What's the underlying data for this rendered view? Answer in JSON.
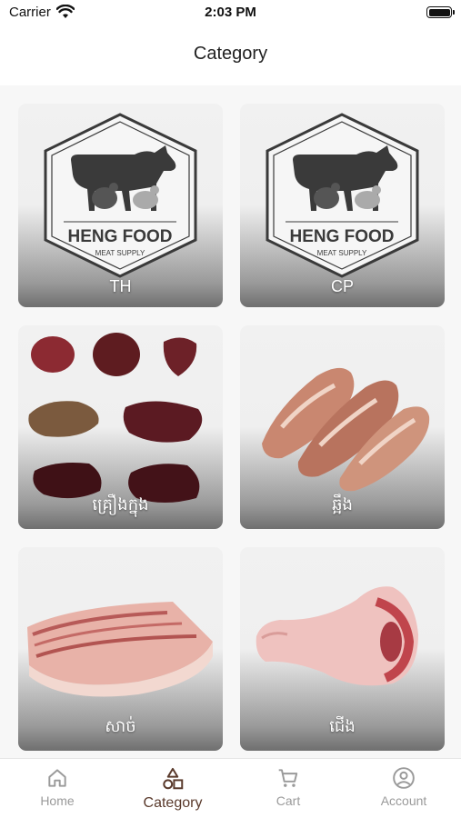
{
  "status_bar": {
    "carrier": "Carrier",
    "time": "2:03 PM"
  },
  "header": {
    "title": "Category"
  },
  "logo": {
    "brand_text": "HENG FOOD",
    "tagline": "MEAT SUPPLY"
  },
  "categories": [
    {
      "label": "TH",
      "image": "heng-food-logo"
    },
    {
      "label": "CP",
      "image": "heng-food-logo"
    },
    {
      "label": "គ្រឿងក្នុង",
      "image": "offal-pieces"
    },
    {
      "label": "ឆ្អឹង",
      "image": "pork-bones"
    },
    {
      "label": "សាច់",
      "image": "pork-belly"
    },
    {
      "label": "ជើង",
      "image": "pork-leg"
    }
  ],
  "tab_bar": {
    "active": "Category",
    "tabs": [
      {
        "label": "Home",
        "icon": "home-icon"
      },
      {
        "label": "Category",
        "icon": "shapes-icon"
      },
      {
        "label": "Cart",
        "icon": "cart-icon"
      },
      {
        "label": "Account",
        "icon": "account-icon"
      }
    ]
  },
  "colors": {
    "accent": "#5a3a2c",
    "inactive": "#9a9a9a",
    "background": "#f7f7f7"
  }
}
